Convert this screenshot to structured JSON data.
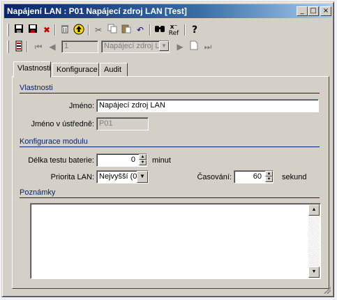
{
  "window": {
    "title": "Napájení LAN : P01 Napájecí zdroj LAN [Test]",
    "controls": {
      "minimize": "_",
      "maximize": "□",
      "close": "×"
    }
  },
  "toolbar1": {
    "icons": [
      "save-icon",
      "save-close-icon",
      "delete-x-icon",
      "trash-icon",
      "up-arrow-icon",
      "cut-icon",
      "copy-icon",
      "paste-icon",
      "undo-icon",
      "find-icon",
      "ref-icon",
      "help-icon"
    ],
    "ref_label": "Ref",
    "help_glyph": "?"
  },
  "toolbar2": {
    "record_value": "1",
    "record_name": "Napájecí zdroj L"
  },
  "tabs": [
    {
      "label": "Vlastnosti",
      "active": true
    },
    {
      "label": "Konfigurace",
      "active": false
    },
    {
      "label": "Audit",
      "active": false
    }
  ],
  "sections": {
    "properties": "Vlastnosti",
    "module_config": "Konfigurace modulu",
    "notes": "Poznámky"
  },
  "form": {
    "name_label": "Jméno:",
    "name_value": "Napájecí zdroj LAN",
    "central_name_label": "Jméno v ústředně:",
    "central_name_value": "P01",
    "battery_test_label": "Délka testu baterie:",
    "battery_test_value": "0",
    "battery_test_unit": "minut",
    "priority_label": "Priorita LAN:",
    "priority_value": "Nejvyšší (0",
    "timing_label": "Časování:",
    "timing_value": "60",
    "timing_unit": "sekund",
    "notes_value": ""
  },
  "colors": {
    "title_gradient_start": "#0a246a",
    "title_gradient_end": "#a6caf0",
    "section_header": "#0a246a",
    "face": "#d4d0c8"
  }
}
